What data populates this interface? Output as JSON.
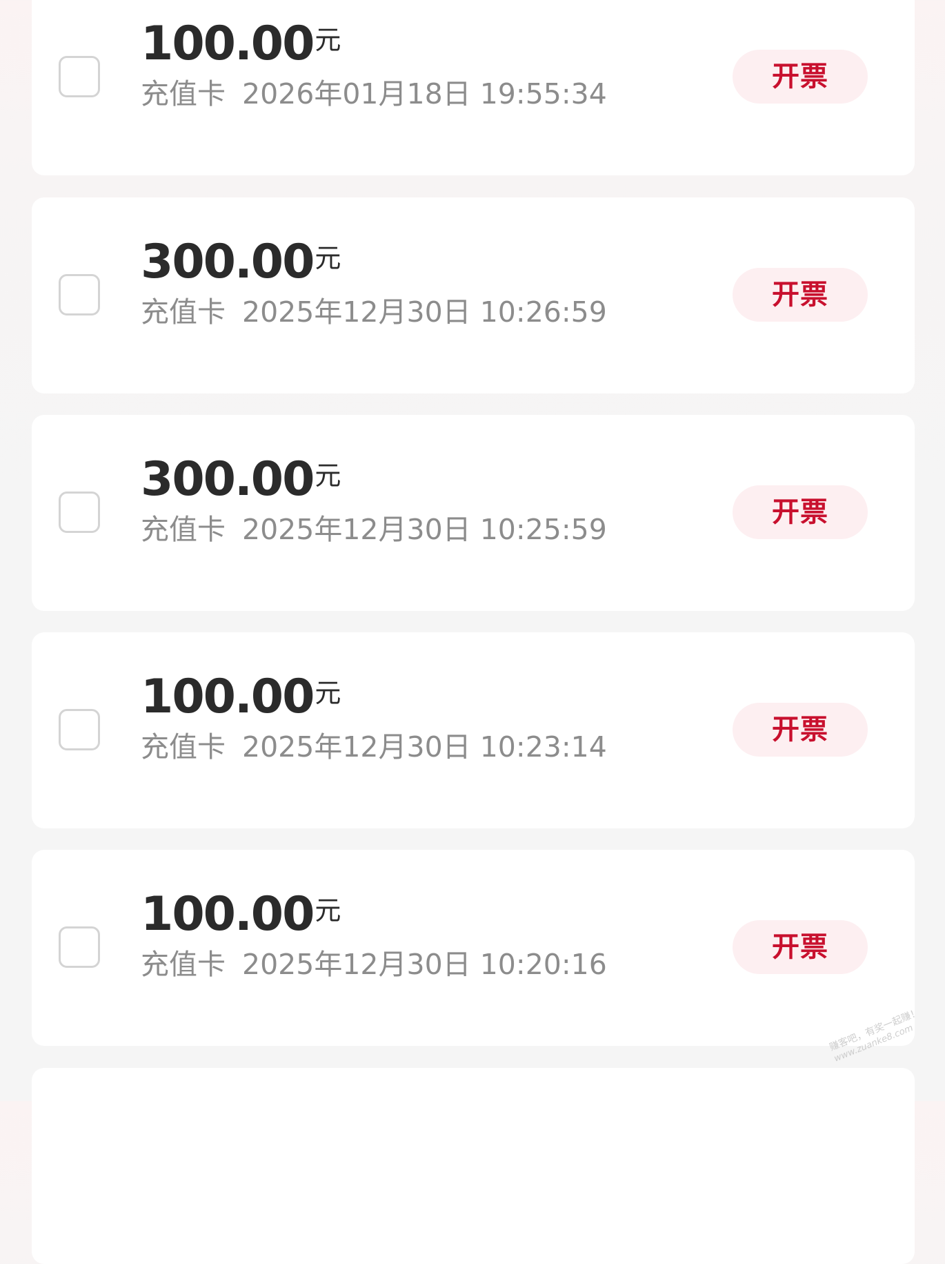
{
  "records": [
    {
      "amount": "100.00",
      "unit": "元",
      "type": "充值卡",
      "datetime": "2026年01月18日 19:55:34",
      "action_label": "开票"
    },
    {
      "amount": "300.00",
      "unit": "元",
      "type": "充值卡",
      "datetime": "2025年12月30日 10:26:59",
      "action_label": "开票"
    },
    {
      "amount": "300.00",
      "unit": "元",
      "type": "充值卡",
      "datetime": "2025年12月30日 10:25:59",
      "action_label": "开票"
    },
    {
      "amount": "100.00",
      "unit": "元",
      "type": "充值卡",
      "datetime": "2025年12月30日 10:23:14",
      "action_label": "开票"
    },
    {
      "amount": "100.00",
      "unit": "元",
      "type": "充值卡",
      "datetime": "2025年12月30日 10:20:16",
      "action_label": "开票"
    }
  ],
  "watermark": {
    "line1": "赚客吧，有奖一起赚！",
    "line2": "www.zuanke8.com"
  },
  "colors": {
    "accent": "#c8102e",
    "button_bg": "#fdeff1",
    "amount_text": "#2b2b2b",
    "meta_text": "#8c8c8c",
    "card_bg": "#ffffff",
    "page_bg": "#f5f5f5"
  }
}
